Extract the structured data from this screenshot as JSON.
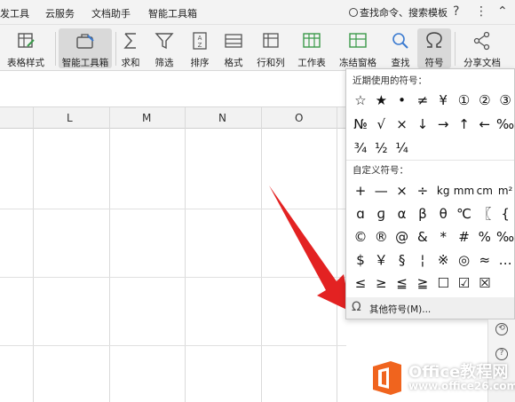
{
  "menubar": {
    "items": [
      "发工具",
      "云服务",
      "文档助手",
      "智能工具箱"
    ],
    "search": "查找命令、搜索模板",
    "help": "?",
    "more": "⋮",
    "collapse": "⌃"
  },
  "ribbon": {
    "buttons": [
      {
        "label": "表格样式",
        "caret": true
      },
      {
        "label": "智能工具箱",
        "caret": false
      },
      {
        "label": "求和",
        "caret": true
      },
      {
        "label": "筛选",
        "caret": true
      },
      {
        "label": "排序",
        "caret": true
      },
      {
        "label": "格式",
        "caret": true
      },
      {
        "label": "行和列",
        "caret": true
      },
      {
        "label": "工作表",
        "caret": true
      },
      {
        "label": "冻结窗格",
        "caret": true
      },
      {
        "label": "查找",
        "caret": true
      },
      {
        "label": "符号",
        "caret": true
      },
      {
        "label": "分享文档",
        "caret": false
      }
    ]
  },
  "sheet": {
    "columns": [
      "L",
      "M",
      "N",
      "O"
    ]
  },
  "symbol_dropdown": {
    "recent_title": "近期使用的符号：",
    "recent": [
      [
        "☆",
        "★",
        "•",
        "≠",
        "¥",
        "①",
        "②",
        "③"
      ],
      [
        "№",
        "√",
        "×",
        "↓",
        "→",
        "↑",
        "←",
        "‰"
      ],
      [
        "¾",
        "½",
        "¼"
      ]
    ],
    "custom_title": "自定义符号：",
    "custom": [
      [
        "+",
        "—",
        "×",
        "÷",
        "kg",
        "mm",
        "cm",
        "m²"
      ],
      [
        "ɑ",
        "ɡ",
        "α",
        "β",
        "θ",
        "℃",
        "〖",
        "{"
      ],
      [
        "©",
        "®",
        "@",
        "&",
        "*",
        "#",
        "%",
        "‰"
      ],
      [
        "$",
        "￥",
        "§",
        "¦",
        "※",
        "◎",
        "≈",
        "…"
      ],
      [
        "≤",
        "≥",
        "≦",
        "≧",
        "☐",
        "☑",
        "☒"
      ]
    ],
    "footer_icon": "Ω",
    "footer": "其他符号(M)..."
  },
  "sidebar": {
    "icons": [
      "history-icon",
      "help-icon"
    ]
  },
  "watermark": {
    "brand": "Office教程网",
    "url": "www.office26.com"
  },
  "colors": {
    "arrow": "#e32222",
    "logo_orange": "#f0641e",
    "active_button": "#d9d9d9"
  }
}
